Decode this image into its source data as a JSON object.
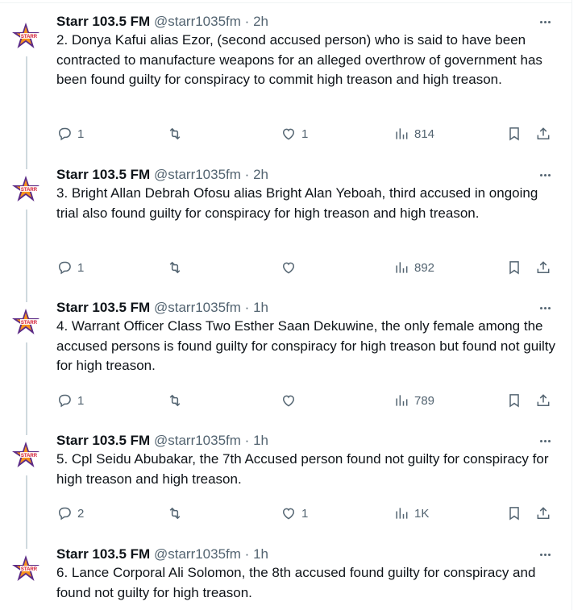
{
  "tweets": [
    {
      "name": "Starr 103.5 FM",
      "handle": "@starr1035fm",
      "time": "2h",
      "text": "2. Donya Kafui alias Ezor, (second accused person) who is said to have been contracted to manufacture weapons for an alleged overthrow of government has been found guilty for conspiracy to commit high treason and high treason.",
      "replies": "1",
      "reposts": "",
      "likes": "1",
      "views": "814"
    },
    {
      "name": "Starr 103.5 FM",
      "handle": "@starr1035fm",
      "time": "2h",
      "text": "3. Bright Allan Debrah Ofosu alias Bright Alan Yeboah, third accused in ongoing trial also found guilty for conspiracy for high treason and high treason.",
      "replies": "1",
      "reposts": "",
      "likes": "",
      "views": "892"
    },
    {
      "name": "Starr 103.5 FM",
      "handle": "@starr1035fm",
      "time": "1h",
      "text": "4. Warrant Officer Class Two Esther Saan Dekuwine, the only female among the accused persons is found guilty for conspiracy for high treason but found not guilty for high treason.",
      "replies": "1",
      "reposts": "",
      "likes": "",
      "views": "789"
    },
    {
      "name": "Starr 103.5 FM",
      "handle": "@starr1035fm",
      "time": "1h",
      "text": "5. Cpl Seidu Abubakar, the 7th Accused person found not guilty for conspiracy for high treason and high treason.",
      "replies": "2",
      "reposts": "",
      "likes": "1",
      "views": "1K"
    },
    {
      "name": "Starr 103.5 FM",
      "handle": "@starr1035fm",
      "time": "1h",
      "text": "6. Lance Corporal Ali Solomon, the 8th accused found guilty for conspiracy and found not guilty for high treason."
    }
  ],
  "separator": "·",
  "avatar_logo_text": "STARR",
  "colors": {
    "text": "#0f1419",
    "secondary": "#536471",
    "thread_line": "#cfd9de",
    "logo_purple": "#5b2a86",
    "logo_orange": "#f7931e"
  },
  "icons": [
    "reply-icon",
    "repost-icon",
    "like-icon",
    "views-icon",
    "bookmark-icon",
    "share-icon",
    "more-icon"
  ]
}
